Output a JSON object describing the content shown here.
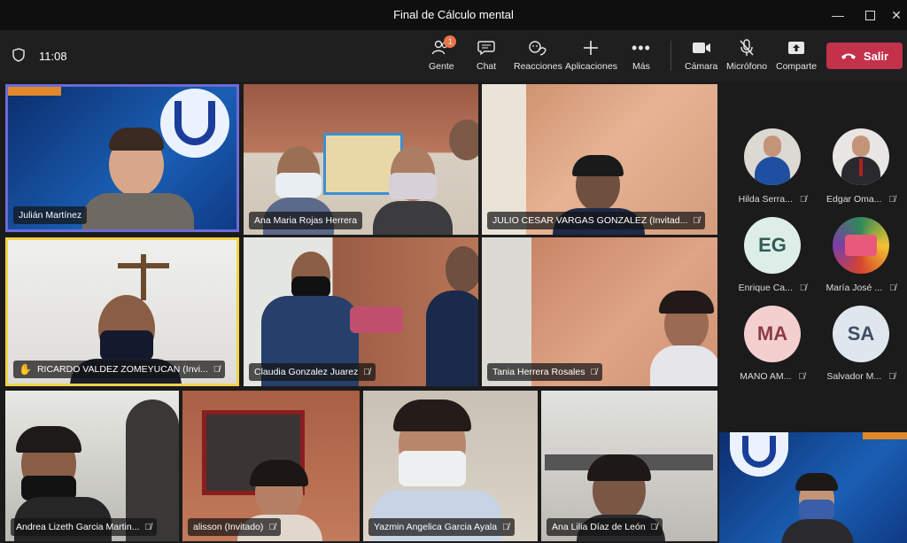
{
  "window": {
    "title": "Final de Cálculo mental"
  },
  "toolbar": {
    "time": "11:08",
    "people_badge": "1",
    "buttons": {
      "people": "Gente",
      "chat": "Chat",
      "reactions": "Reacciones",
      "apps": "Aplicaciones",
      "more": "Más",
      "camera": "Cámara",
      "mic": "Micrófono",
      "share": "Comparte"
    },
    "leave": "Salir"
  },
  "tiles": [
    {
      "name": "Julián Martínez"
    },
    {
      "name": "Ana Maria Rojas Herrera"
    },
    {
      "name": "JULIO CESAR VARGAS GONZALEZ (Invitad..."
    },
    {
      "name": "RICARDO VALDEZ ZOMEYUCAN (Invi..."
    },
    {
      "name": "Claudia Gonzalez Juarez"
    },
    {
      "name": "Tania Herrera Rosales"
    },
    {
      "name": "Andrea Lizeth Garcia Martin..."
    },
    {
      "name": "alisson (Invitado)"
    },
    {
      "name": "Yazmin Angelica Garcia Ayala"
    },
    {
      "name": "Ana Lilia Díaz de León"
    }
  ],
  "side": [
    {
      "name": "Hilda Serra...",
      "initials": ""
    },
    {
      "name": "Edgar Oma...",
      "initials": ""
    },
    {
      "name": "Enrique Ca...",
      "initials": "EG"
    },
    {
      "name": "María José ...",
      "initials": ""
    },
    {
      "name": "MANO AM...",
      "initials": "MA"
    },
    {
      "name": "Salvador M...",
      "initials": "SA"
    }
  ],
  "colors": {
    "leave": "#c4314b",
    "active_speaker": "#6b6bd8",
    "raised_hand": "#f2d24b"
  }
}
